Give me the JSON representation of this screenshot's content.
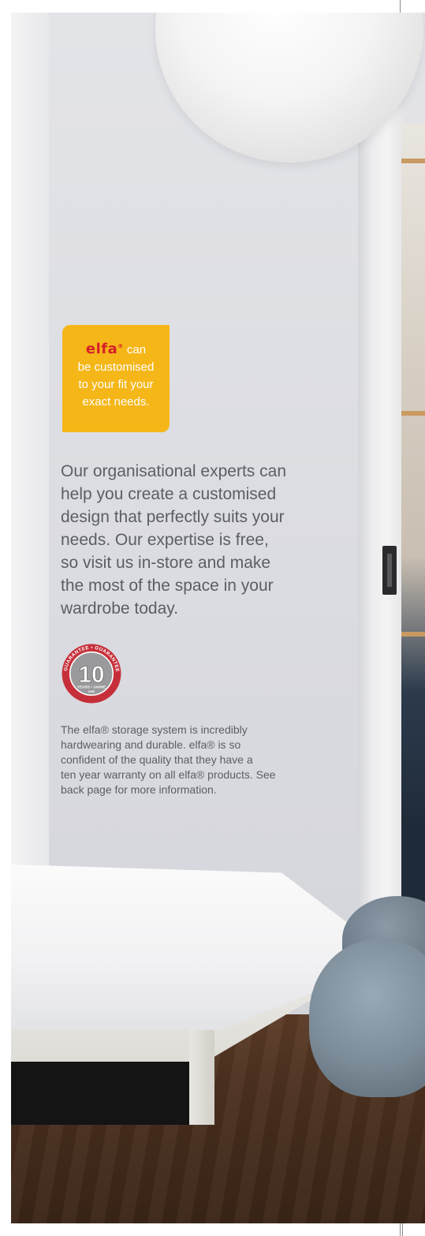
{
  "badge": {
    "logo": "elfa",
    "logo_mark": "®",
    "lines": [
      "can",
      "be customised",
      "to your fit your",
      "exact needs."
    ]
  },
  "intro": {
    "lines": [
      "Our organisational experts can",
      "help you create a customised",
      "design that perfectly suits your",
      "needs. Our expertise is free,",
      "so visit us in-store and make",
      "the most of the space in your",
      "wardrobe today."
    ]
  },
  "seal": {
    "number": "10",
    "ring_text": "GUARANTEE • GUARANTEE • WARRANTY",
    "bottom_text": "YEARS • JAHRE",
    "bottom_text2": "ANS",
    "colors": {
      "ring": "#c62f3a",
      "face": "#9a9a9c"
    }
  },
  "warranty": {
    "lines": [
      "The elfa® storage system is incredibly",
      "hardwearing and durable. elfa® is so",
      "confident of the quality that they have a",
      "ten year warranty on all elfa® products. See",
      "back page for more information."
    ]
  },
  "colors": {
    "badge": "#f5b618",
    "logo": "#d6202a",
    "text": "#5b5e63"
  }
}
